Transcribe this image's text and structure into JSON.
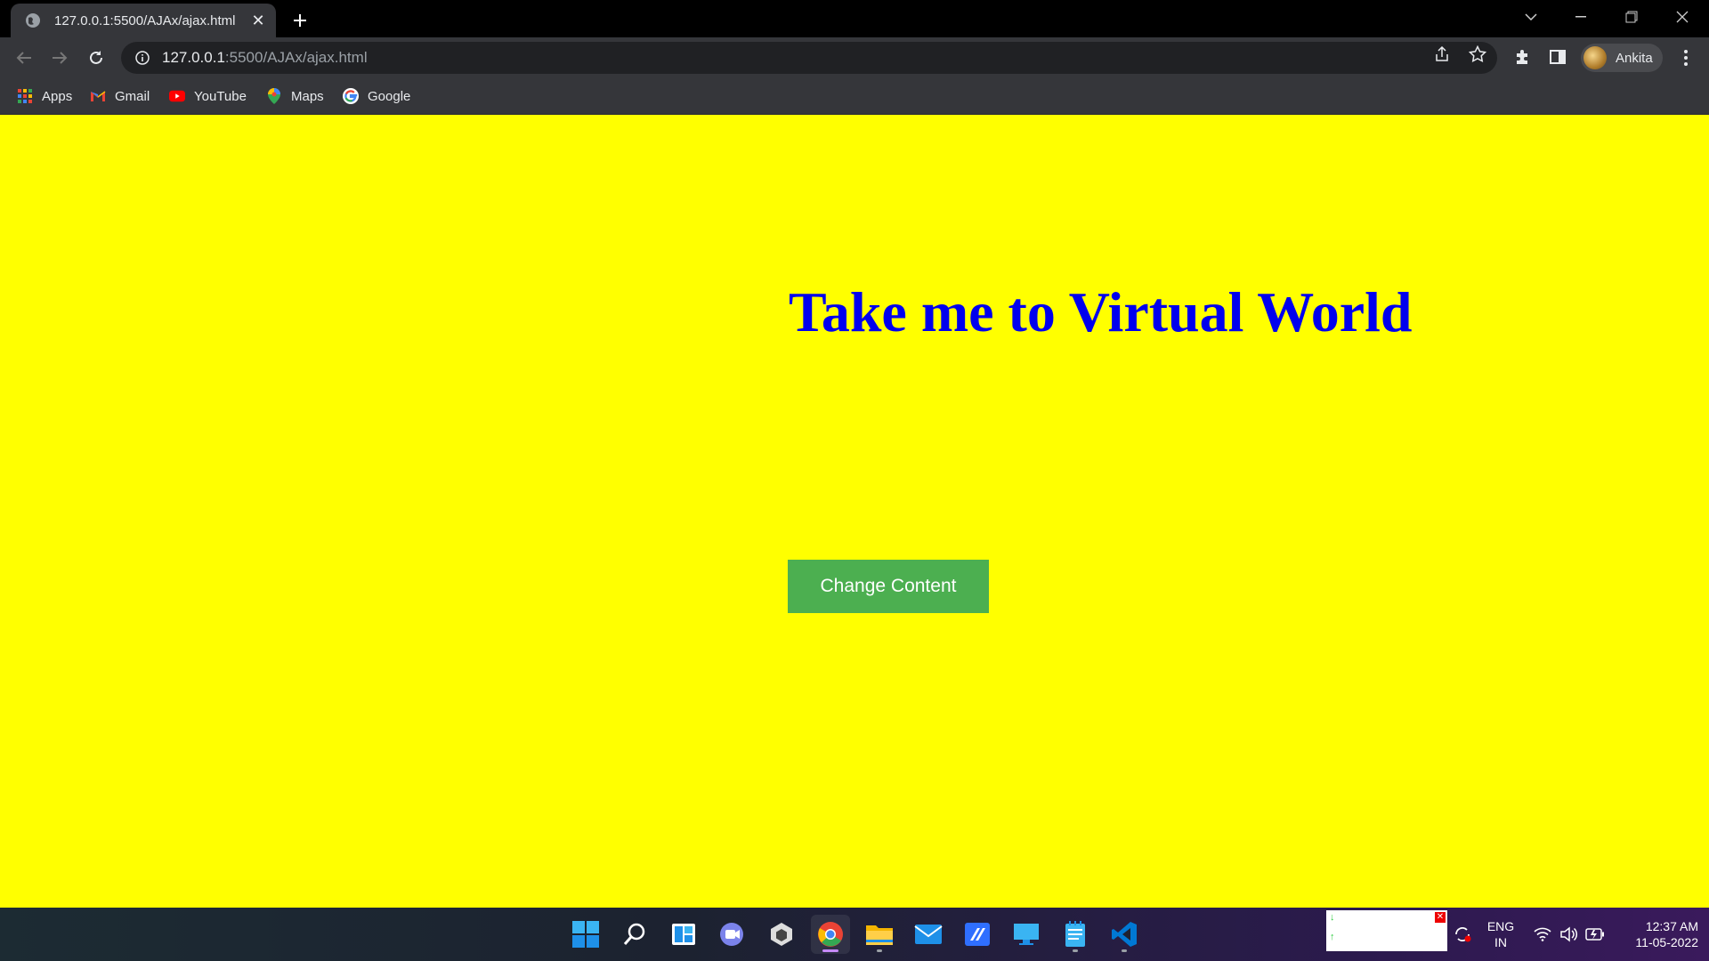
{
  "browser": {
    "tab": {
      "title": "127.0.0.1:5500/AJAx/ajax.html",
      "favicon": "globe-icon"
    },
    "address": {
      "host": "127.0.0.1",
      "path": ":5500/AJAx/ajax.html"
    },
    "profile": {
      "name": "Ankita"
    },
    "bookmarks": [
      {
        "label": "Apps",
        "icon": "apps-grid-icon"
      },
      {
        "label": "Gmail",
        "icon": "gmail-icon"
      },
      {
        "label": "YouTube",
        "icon": "youtube-icon"
      },
      {
        "label": "Maps",
        "icon": "maps-icon"
      },
      {
        "label": "Google",
        "icon": "google-icon"
      }
    ]
  },
  "page": {
    "background": "#ffff00",
    "heading": "Take me to Virtual World",
    "heading_color": "#0000ee",
    "button_label": "Change Content",
    "button_color": "#4caf50"
  },
  "taskbar": {
    "apps": [
      "start-icon",
      "search-icon",
      "widgets-icon",
      "teams-chat-icon",
      "unity-icon",
      "chrome-icon",
      "file-explorer-icon",
      "mail-icon",
      "app-icon",
      "remote-desktop-icon",
      "notepad-icon",
      "vscode-icon"
    ],
    "language": {
      "line1": "ENG",
      "line2": "IN"
    },
    "clock": {
      "time": "12:37 AM",
      "date": "11-05-2022"
    }
  }
}
